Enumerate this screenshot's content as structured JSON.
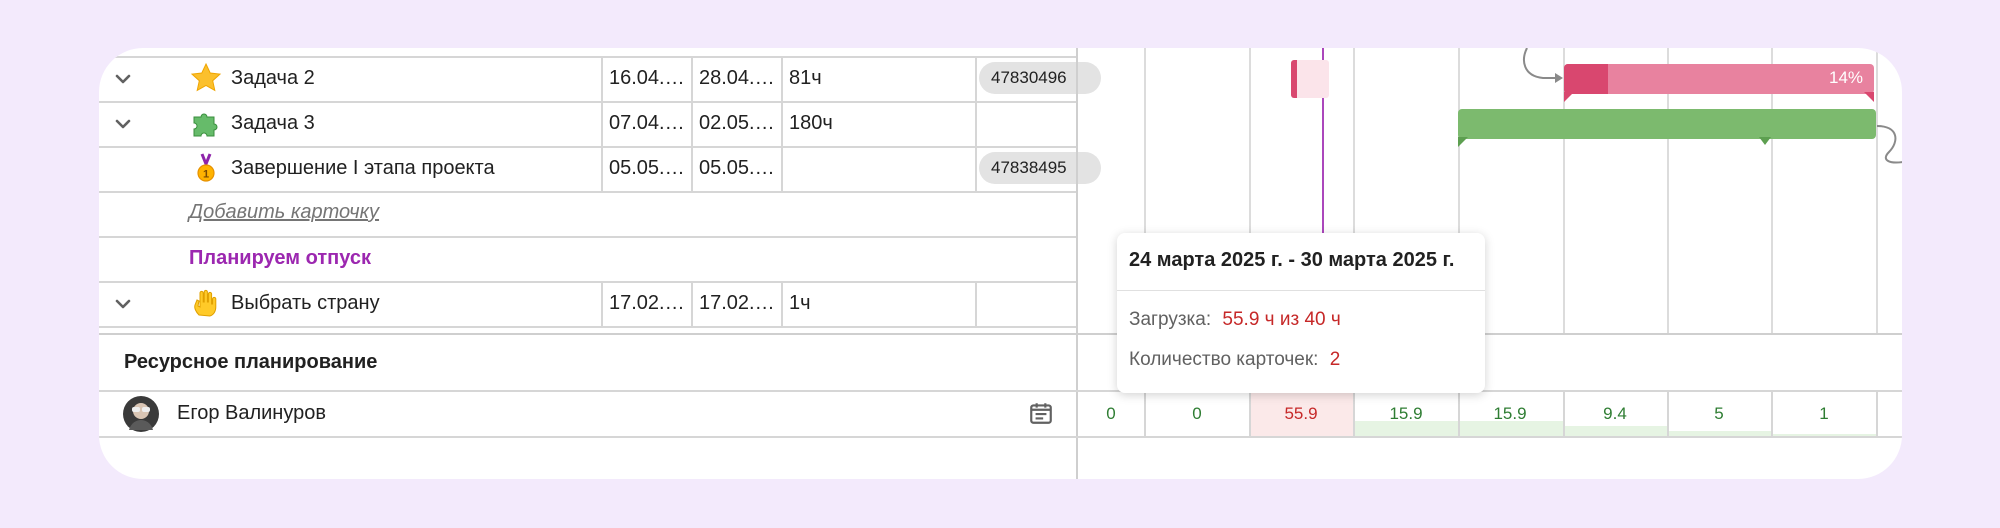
{
  "tasks": [
    {
      "name": "Задача 2",
      "icon": "star-icon",
      "start": "16.04.…",
      "end": "28.04.…",
      "hours": "81ч",
      "id": "47830496"
    },
    {
      "name": "Задача 3",
      "icon": "puzzle-icon",
      "start": "07.04.…",
      "end": "02.05.…",
      "hours": "180ч",
      "id": ""
    },
    {
      "name": "Завершение I этапа проекта",
      "icon": "medal-icon",
      "start": "05.05.…",
      "end": "05.05.…",
      "hours": "",
      "id": "47838495"
    }
  ],
  "add_card_label": "Добавить карточку",
  "group_label": "Планируем отпуск",
  "task_after_group": {
    "name": "Выбрать страну",
    "icon": "hand-icon",
    "start": "17.02.…",
    "end": "17.02.…",
    "hours": "1ч"
  },
  "gantt": {
    "task2_progress": "14%",
    "task2_progress_value": 0.14
  },
  "resources": {
    "title": "Ресурсное планирование",
    "person": "Егор Валинуров",
    "loads": [
      "0",
      "0",
      "55.9",
      "15.9",
      "15.9",
      "9.4",
      "5",
      "1"
    ],
    "load_values": [
      0,
      0,
      55.9,
      15.9,
      15.9,
      9.4,
      5,
      1
    ]
  },
  "tooltip": {
    "title": "24 марта 2025 г. - 30 марта 2025 г.",
    "load_label": "Загрузка:",
    "load_value": "55.9 ч из 40 ч",
    "cards_label": "Количество карточек:",
    "cards_value": "2"
  },
  "colors": {
    "accent_purple": "#9c27b0",
    "bar_pink": "#e8829f",
    "bar_green": "#7cba6e",
    "overload_red": "#c62828"
  }
}
